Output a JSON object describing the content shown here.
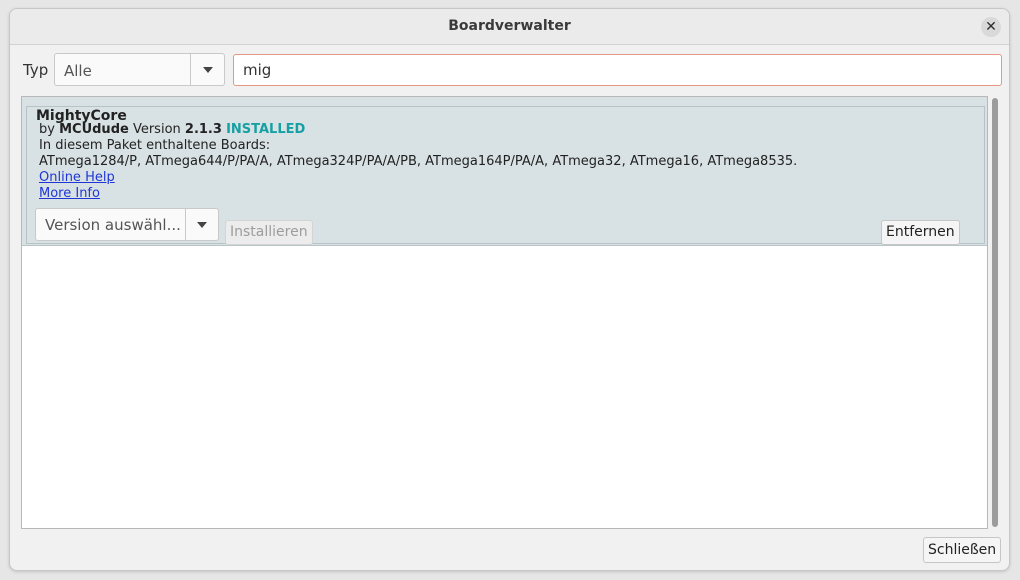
{
  "window": {
    "title": "Boardverwalter",
    "close_glyph": "✕"
  },
  "filter": {
    "type_label": "Typ",
    "type_value": "Alle",
    "search_value": "mig"
  },
  "entries": [
    {
      "name": "MightyCore",
      "by_label": "by",
      "author": "MCUdude",
      "version_label": "Version",
      "version": "2.1.3",
      "status": "INSTALLED",
      "boards_heading": "In diesem Paket enthaltene Boards:",
      "boards_list": "ATmega1284/P, ATmega644/P/PA/A, ATmega324P/PA/A/PB, ATmega164P/PA/A, ATmega32, ATmega16, ATmega8535.",
      "online_help": "Online Help",
      "more_info": "More Info",
      "version_select_placeholder": "Version auswähl...",
      "install_button": "Installieren",
      "remove_button": "Entfernen"
    }
  ],
  "footer": {
    "close_button": "Schließen"
  },
  "colors": {
    "installed": "#16a0a3",
    "link": "#1f36d6",
    "entry_bg": "#d8e1e3",
    "search_border": "#e29a87"
  },
  "icons": {
    "close": "close-icon",
    "dropdown": "chevron-down-icon"
  }
}
